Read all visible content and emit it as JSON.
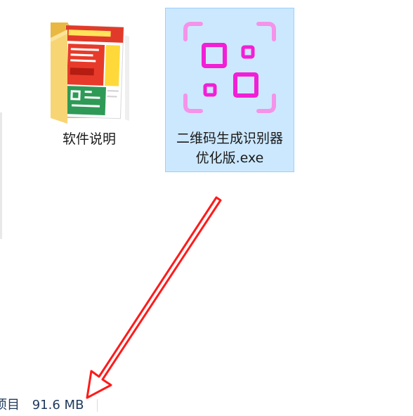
{
  "files": [
    {
      "name": "软件说明",
      "type": "folder",
      "icon": "folder-icon",
      "selected": false
    },
    {
      "name": "二维码生成识别器优化版.exe",
      "type": "executable",
      "icon": "qr-code-app-icon",
      "selected": true
    }
  ],
  "status_bar": {
    "items_label": "项目",
    "size_label": "91.6 MB"
  },
  "annotation": {
    "icon": "red-arrow-icon",
    "color": "#ff1a1a"
  },
  "colors": {
    "selection_bg": "#cce8ff",
    "selection_border": "#99d1ff",
    "qr_magenta": "#f21fd6",
    "qr_corner_pink": "#f593ea",
    "folder_yellow": "#f8d574"
  }
}
